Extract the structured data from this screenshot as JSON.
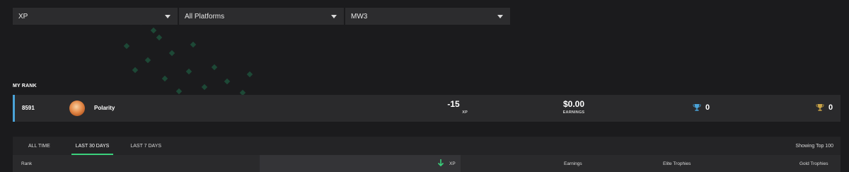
{
  "filters": [
    {
      "value": "XP"
    },
    {
      "value": "All Platforms"
    },
    {
      "value": "MW3"
    }
  ],
  "my_rank": {
    "label": "MY RANK",
    "rank": "8591",
    "player_name": "Polarity",
    "xp_value": "-15",
    "xp_label": "XP",
    "earnings_value": "$0.00",
    "earnings_label": "EARNINGS",
    "elite_trophies": "0",
    "gold_trophies": "0"
  },
  "leaderboard": {
    "tabs": [
      {
        "label": "ALL TIME",
        "active": false
      },
      {
        "label": "LAST 30 DAYS",
        "active": true
      },
      {
        "label": "LAST 7 DAYS",
        "active": false
      }
    ],
    "showing": "Showing Top 100",
    "columns": {
      "rank": "Rank",
      "xp": "XP",
      "earnings": "Earnings",
      "elite": "Elite Trophies",
      "gold": "Gold Trophies"
    }
  },
  "colors": {
    "accent_green": "#3ad07b",
    "rank_border_blue": "#4aa3d8",
    "elite_trophy": "#4aa3d8",
    "gold_trophy": "#c9a347"
  },
  "icons": [
    "chevron-down-icon",
    "avatar",
    "elite-trophy-icon",
    "gold-trophy-icon",
    "sort-down-arrow-icon"
  ]
}
